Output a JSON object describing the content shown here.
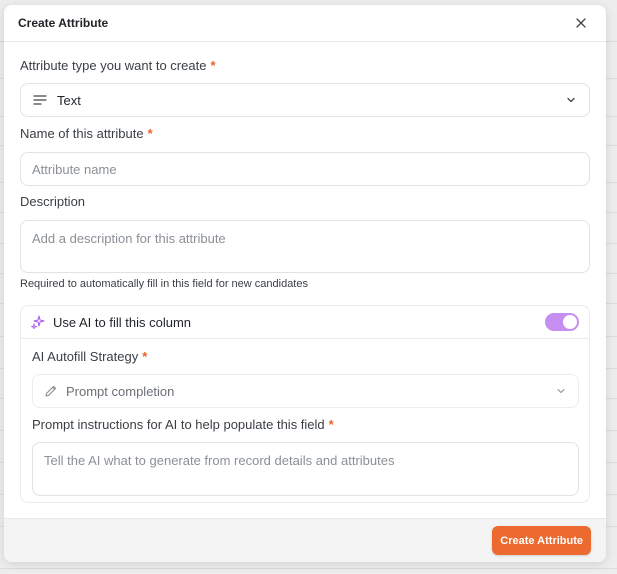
{
  "modal": {
    "title": "Create Attribute",
    "submit_label": "Create Attribute"
  },
  "attribute_type": {
    "label": "Attribute type you want to create",
    "required_mark": "*",
    "value": "Text",
    "icon": "text-lines-icon"
  },
  "attribute_name": {
    "label": "Name of this attribute",
    "required_mark": "*",
    "placeholder": "Attribute name",
    "value": ""
  },
  "description": {
    "label": "Description",
    "placeholder": "Add a description for this attribute",
    "value": "",
    "hint": "Required to automatically fill in this field for new candidates"
  },
  "ai_fill": {
    "label": "Use AI to fill this column",
    "enabled": true,
    "icon": "sparkles-icon",
    "toggle_color": "#c58ef0",
    "strategy": {
      "label": "AI Autofill Strategy",
      "required_mark": "*",
      "value": "Prompt completion",
      "icon": "pencil-icon"
    },
    "prompt": {
      "label": "Prompt instructions for AI to help populate this field",
      "required_mark": "*",
      "placeholder": "Tell the AI what to generate from record details and attributes",
      "value": ""
    }
  },
  "colors": {
    "accent": "#ec6a2f",
    "required": "#e8622a"
  }
}
